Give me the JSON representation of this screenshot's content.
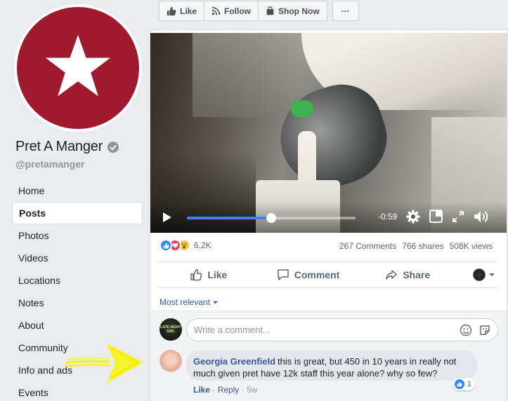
{
  "page": {
    "name": "Pret A Manger",
    "handle": "@pretamanger",
    "brand_color": "#a0192f",
    "avatar_icon": "white-star-icon"
  },
  "nav": {
    "items": [
      "Home",
      "Posts",
      "Photos",
      "Videos",
      "Locations",
      "Notes",
      "About",
      "Community",
      "Info and ads",
      "Events"
    ],
    "active": "Posts"
  },
  "action_bar": {
    "like": "Like",
    "follow": "Follow",
    "shop_now": "Shop Now",
    "more": "···"
  },
  "video": {
    "time_remaining": "-0:59",
    "progress": 0.5,
    "accent": "#4080ff"
  },
  "stats": {
    "reactions_count": "6.2K",
    "reaction_types": [
      "like",
      "love",
      "wow"
    ],
    "comments": "267 Comments",
    "shares": "766 shares",
    "views": "508K views"
  },
  "post_actions": {
    "like": "Like",
    "comment": "Comment",
    "share": "Share"
  },
  "comments": {
    "sort": "Most relevant",
    "input_placeholder": "Write a comment...",
    "my_avatar_text": "LATE NIGHT GIRL",
    "items": [
      {
        "author": "Georgia Greenfield",
        "text": "this is great, but 450 in 10 years in really not much given pret have 12k staff this year alone? why so few?",
        "like_label": "Like",
        "reply_label": "Reply",
        "time": "5w",
        "likes": "1"
      }
    ]
  },
  "annotation": {
    "arrow_color": "#f7f21a",
    "arrow_icon": "yellow-arrow-right-icon"
  }
}
